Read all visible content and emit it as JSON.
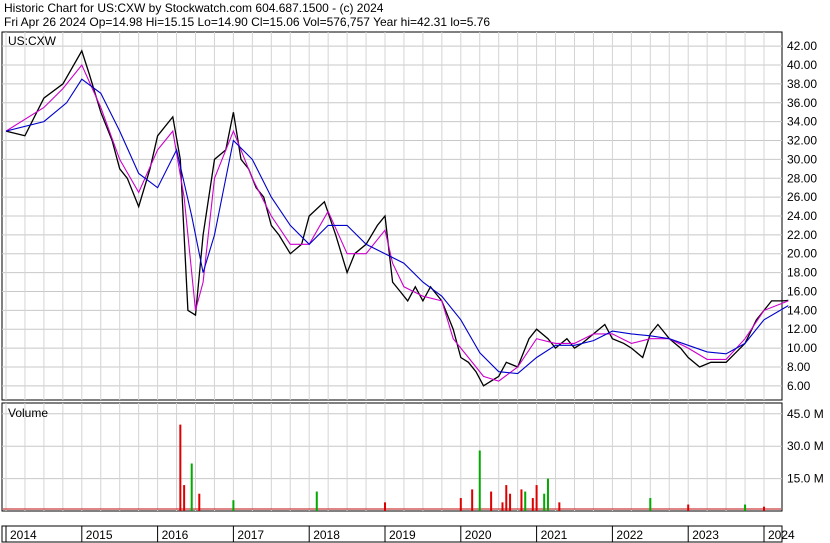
{
  "header": {
    "line1": "Historic Chart for US:CXW by Stockwatch.com 604.687.1500 - (c) 2024",
    "line2": "Fri Apr 26 2024   Op=14.98  Hi=15.15  Lo=14.90  Cl=15.06  Vol=576,757  Year hi=42.31  lo=5.76"
  },
  "chart_data": [
    {
      "type": "line",
      "title": "US:CXW",
      "ylim": [
        4.5,
        43.5
      ],
      "y_ticks": [
        "6.00",
        "8.00",
        "10.00",
        "12.00",
        "14.00",
        "16.00",
        "18.00",
        "20.00",
        "22.00",
        "24.00",
        "26.00",
        "28.00",
        "30.00",
        "32.00",
        "34.00",
        "36.00",
        "38.00",
        "40.00",
        "42.00"
      ],
      "x_ticks": [
        "2014",
        "2015",
        "2016",
        "2017",
        "2018",
        "2019",
        "2020",
        "2021",
        "2022",
        "2023",
        "2024"
      ],
      "grid": true,
      "series": [
        {
          "role": "price",
          "color": "#000000",
          "x": [
            2014.0,
            2014.25,
            2014.5,
            2014.75,
            2015.0,
            2015.1,
            2015.25,
            2015.4,
            2015.5,
            2015.6,
            2015.75,
            2015.9,
            2016.0,
            2016.2,
            2016.3,
            2016.4,
            2016.5,
            2016.6,
            2016.75,
            2016.9,
            2017.0,
            2017.1,
            2017.2,
            2017.3,
            2017.4,
            2017.5,
            2017.6,
            2017.75,
            2017.9,
            2018.0,
            2018.2,
            2018.35,
            2018.5,
            2018.6,
            2018.75,
            2018.9,
            2019.0,
            2019.1,
            2019.2,
            2019.3,
            2019.4,
            2019.5,
            2019.6,
            2019.75,
            2019.9,
            2020.0,
            2020.1,
            2020.2,
            2020.3,
            2020.4,
            2020.5,
            2020.6,
            2020.75,
            2020.9,
            2021.0,
            2021.15,
            2021.25,
            2021.4,
            2021.5,
            2021.6,
            2021.75,
            2021.9,
            2022.0,
            2022.15,
            2022.25,
            2022.4,
            2022.5,
            2022.6,
            2022.75,
            2022.9,
            2023.0,
            2023.15,
            2023.3,
            2023.5,
            2023.75,
            2023.9,
            2024.0,
            2024.1,
            2024.25,
            2024.32
          ],
          "values": [
            33,
            32.5,
            36.5,
            38,
            41.5,
            39,
            35,
            32,
            29,
            28,
            25,
            29,
            32.5,
            34.5,
            30,
            14,
            13.5,
            22,
            30,
            31,
            35,
            30,
            29,
            27,
            26,
            23,
            22,
            20,
            21,
            24,
            25.5,
            22,
            18,
            20,
            21,
            23,
            24,
            17,
            16,
            15,
            16.5,
            15,
            16.5,
            15,
            12,
            9,
            8.5,
            7.5,
            6,
            6.5,
            7,
            8.5,
            8,
            11,
            12,
            11,
            10,
            11,
            10,
            10.5,
            11.5,
            12.5,
            11,
            10.5,
            10,
            9,
            11.5,
            12.5,
            11,
            10,
            9,
            8,
            8.5,
            8.5,
            10.5,
            13,
            14,
            15,
            15,
            15.06
          ]
        },
        {
          "role": "short moving average",
          "color": "#cc00cc",
          "x": [
            2014.0,
            2014.5,
            2014.75,
            2015.0,
            2015.25,
            2015.5,
            2015.75,
            2016.0,
            2016.2,
            2016.35,
            2016.5,
            2016.6,
            2016.75,
            2017.0,
            2017.25,
            2017.5,
            2017.75,
            2018.0,
            2018.25,
            2018.5,
            2018.75,
            2019.0,
            2019.1,
            2019.25,
            2019.5,
            2019.75,
            2019.9,
            2020.1,
            2020.3,
            2020.5,
            2020.75,
            2021.0,
            2021.25,
            2021.5,
            2021.75,
            2022.0,
            2022.25,
            2022.5,
            2022.75,
            2023.0,
            2023.25,
            2023.5,
            2023.75,
            2024.0,
            2024.32
          ],
          "values": [
            33,
            35.5,
            37.5,
            40,
            35.5,
            30,
            26.5,
            31,
            33,
            26,
            14,
            17,
            28,
            33,
            28,
            24,
            21,
            21,
            24.5,
            20,
            20,
            22.5,
            19,
            16.5,
            15.5,
            15,
            11,
            9,
            7,
            6.5,
            8,
            11,
            10.5,
            10.5,
            11.5,
            11.5,
            10.5,
            11,
            11,
            10,
            8.8,
            8.8,
            11,
            14,
            15
          ]
        },
        {
          "role": "long moving average",
          "color": "#0000cc",
          "x": [
            2014.0,
            2014.5,
            2014.8,
            2015.0,
            2015.25,
            2015.5,
            2015.75,
            2016.0,
            2016.25,
            2016.45,
            2016.6,
            2016.75,
            2016.9,
            2017.0,
            2017.25,
            2017.5,
            2017.75,
            2018.0,
            2018.25,
            2018.5,
            2018.75,
            2019.0,
            2019.25,
            2019.5,
            2019.75,
            2020.0,
            2020.25,
            2020.5,
            2020.75,
            2021.0,
            2021.25,
            2021.5,
            2021.75,
            2022.0,
            2022.25,
            2022.5,
            2022.75,
            2023.0,
            2023.25,
            2023.5,
            2023.75,
            2024.0,
            2024.32
          ],
          "values": [
            33,
            34,
            36,
            38.5,
            37,
            33,
            28.5,
            27,
            31,
            24,
            18,
            22,
            28,
            32,
            30,
            26,
            23,
            21,
            23,
            23,
            21,
            20,
            19,
            17,
            15.5,
            13,
            9.5,
            7.5,
            7.3,
            9,
            10.3,
            10.3,
            10.8,
            11.8,
            11.5,
            11.3,
            11,
            10.3,
            9.6,
            9.4,
            10.5,
            13,
            14.5
          ]
        }
      ]
    },
    {
      "type": "bar",
      "title": "Volume",
      "ylim": [
        0,
        50
      ],
      "y_ticks": [
        "15.0 M",
        "30.0 M",
        "45.0 M"
      ],
      "grid": true,
      "series": [
        {
          "name": "Volume",
          "x": [
            2016.3,
            2016.35,
            2016.45,
            2016.55,
            2017.0,
            2018.1,
            2019.0,
            2020.0,
            2020.15,
            2020.25,
            2020.4,
            2020.55,
            2020.6,
            2020.65,
            2020.8,
            2020.85,
            2020.95,
            2021.0,
            2021.1,
            2021.15,
            2021.3,
            2022.5,
            2023.0,
            2023.75,
            2024.0
          ],
          "values": [
            40,
            12,
            22,
            8,
            5,
            9,
            4,
            6,
            10,
            28,
            9,
            4,
            12,
            8,
            10,
            9,
            6,
            12,
            8,
            15,
            4,
            6,
            3,
            3,
            2
          ],
          "colors": [
            "#dd0000",
            "#dd0000",
            "#00aa00",
            "#dd0000",
            "#00aa00",
            "#00aa00",
            "#dd0000",
            "#dd0000",
            "#dd0000",
            "#00aa00",
            "#dd0000",
            "#dd0000",
            "#dd0000",
            "#dd0000",
            "#dd0000",
            "#00aa00",
            "#dd0000",
            "#dd0000",
            "#00aa00",
            "#00aa00",
            "#dd0000",
            "#00aa00",
            "#dd0000",
            "#00aa00",
            "#dd0000"
          ]
        }
      ]
    }
  ]
}
